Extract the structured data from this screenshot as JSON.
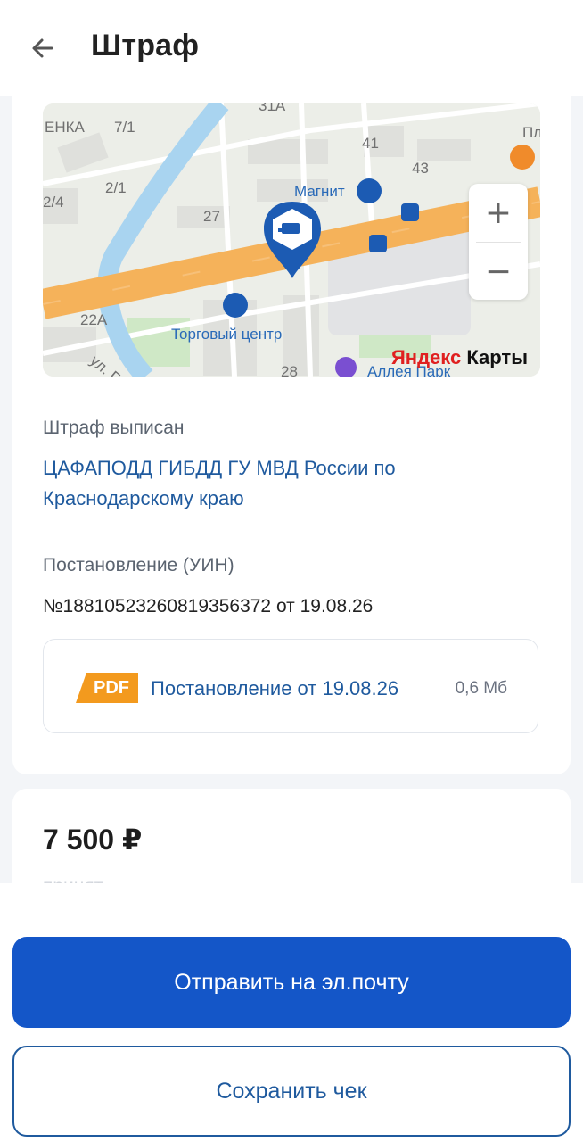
{
  "header": {
    "title": "Штраф",
    "back_icon": "arrow-left-icon"
  },
  "map": {
    "labels": {
      "l1": "ЕНКА",
      "l2": "7/1",
      "l3": "2/1",
      "l4": "2/4",
      "l5": "31А",
      "l6": "41",
      "l7": "43",
      "l8": "27",
      "l9": "22А",
      "l10": "28",
      "l11": "ул. Га",
      "l12": "Пл",
      "magnit": "Магнит",
      "mall": "Торговый центр",
      "park": "Аллея Парк"
    },
    "zoom_in": "+",
    "zoom_out": "−",
    "logo_part1": "Яндекс",
    "logo_part2": " Карты"
  },
  "fine": {
    "issued_by_label": "Штраф выписан",
    "issued_by": "ЦАФАПОДД ГИБДД ГУ МВД России по Краснодарскому краю",
    "resolution_label": "Постановление (УИН)",
    "resolution_number": "№18810523260819356372 от 19.08.26",
    "document": {
      "badge": "PDF",
      "title": "Постановление от 19.08.26",
      "size": "0,6 Мб"
    }
  },
  "payment": {
    "amount": "7 500 ₽",
    "status": "принят"
  },
  "actions": {
    "send_email": "Отправить на эл.почту",
    "save_receipt": "Сохранить чек"
  },
  "colors": {
    "accent": "#1456c8",
    "link": "#1f5a9e",
    "road": "#f5b25a",
    "river": "#a9d4f0",
    "pin": "#1c5bb3",
    "pdf": "#f39a1e"
  }
}
